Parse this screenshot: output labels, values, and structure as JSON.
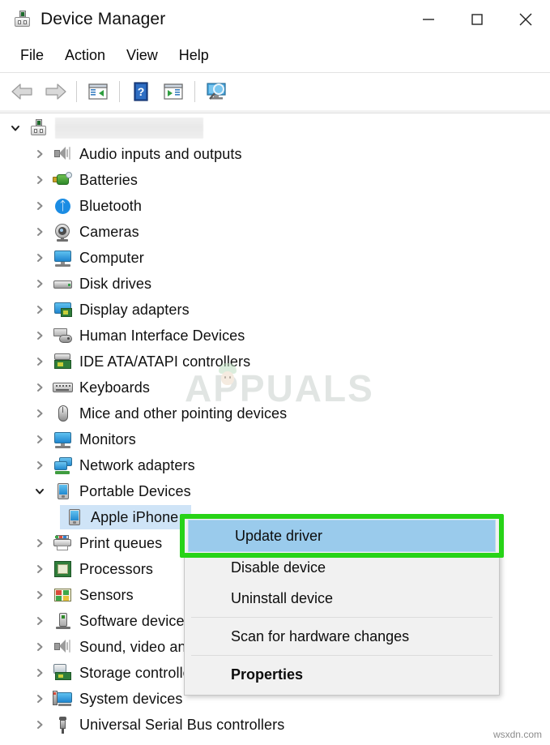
{
  "window": {
    "title": "Device Manager",
    "title_icon": "device-manager-icon",
    "controls": {
      "minimize": "–",
      "maximize": "□",
      "close": "✕"
    }
  },
  "menubar": {
    "items": [
      {
        "label": "File"
      },
      {
        "label": "Action"
      },
      {
        "label": "View"
      },
      {
        "label": "Help"
      }
    ]
  },
  "toolbar": {
    "buttons": [
      {
        "name": "back-button",
        "icon": "back-arrow-icon"
      },
      {
        "name": "forward-button",
        "icon": "forward-arrow-icon"
      },
      {
        "name": "properties-button",
        "icon": "properties-window-icon"
      },
      {
        "name": "help-button",
        "icon": "help-question-icon"
      },
      {
        "name": "update-driver-button",
        "icon": "play-window-icon"
      },
      {
        "name": "scan-hardware-button",
        "icon": "scan-monitor-icon"
      }
    ]
  },
  "tree": {
    "root": {
      "label": "",
      "redacted": true,
      "icon": "computer-root-icon",
      "expanded": true
    },
    "items": [
      {
        "label": "Audio inputs and outputs",
        "icon": "speaker-icon",
        "depth": 1,
        "expanded": false
      },
      {
        "label": "Batteries",
        "icon": "battery-icon",
        "depth": 1,
        "expanded": false
      },
      {
        "label": "Bluetooth",
        "icon": "bluetooth-icon",
        "depth": 1,
        "expanded": false
      },
      {
        "label": "Cameras",
        "icon": "camera-icon",
        "depth": 1,
        "expanded": false
      },
      {
        "label": "Computer",
        "icon": "monitor-icon",
        "depth": 1,
        "expanded": false
      },
      {
        "label": "Disk drives",
        "icon": "disk-drive-icon",
        "depth": 1,
        "expanded": false
      },
      {
        "label": "Display adapters",
        "icon": "display-adapter-icon",
        "depth": 1,
        "expanded": false
      },
      {
        "label": "Human Interface Devices",
        "icon": "hid-icon",
        "depth": 1,
        "expanded": false
      },
      {
        "label": "IDE ATA/ATAPI controllers",
        "icon": "ide-controller-icon",
        "depth": 1,
        "expanded": false
      },
      {
        "label": "Keyboards",
        "icon": "keyboard-icon",
        "depth": 1,
        "expanded": false
      },
      {
        "label": "Mice and other pointing devices",
        "icon": "mouse-icon",
        "depth": 1,
        "expanded": false
      },
      {
        "label": "Monitors",
        "icon": "monitor-icon",
        "depth": 1,
        "expanded": false
      },
      {
        "label": "Network adapters",
        "icon": "network-adapter-icon",
        "depth": 1,
        "expanded": false
      },
      {
        "label": "Portable Devices",
        "icon": "portable-device-icon",
        "depth": 1,
        "expanded": true
      },
      {
        "label": "Apple iPhone",
        "icon": "portable-device-icon",
        "depth": 2,
        "selected": true
      },
      {
        "label": "Print queues",
        "icon": "printer-icon",
        "depth": 1,
        "expanded": false
      },
      {
        "label": "Processors",
        "icon": "processor-icon",
        "depth": 1,
        "expanded": false
      },
      {
        "label": "Sensors",
        "icon": "sensor-icon",
        "depth": 1,
        "expanded": false
      },
      {
        "label": "Software devices",
        "icon": "software-device-icon",
        "depth": 1,
        "expanded": false
      },
      {
        "label": "Sound, video and game controllers",
        "icon": "speaker-icon",
        "depth": 1,
        "expanded": false
      },
      {
        "label": "Storage controllers",
        "icon": "storage-controller-icon",
        "depth": 1,
        "expanded": false
      },
      {
        "label": "System devices",
        "icon": "system-device-icon",
        "depth": 1,
        "expanded": false
      },
      {
        "label": "Universal Serial Bus controllers",
        "icon": "usb-icon",
        "depth": 1,
        "expanded": false
      }
    ]
  },
  "context_menu": {
    "items": [
      {
        "label": "Update driver",
        "highlighted": true,
        "bold": false
      },
      {
        "label": "Disable device",
        "highlighted": false,
        "bold": false
      },
      {
        "label": "Uninstall device",
        "highlighted": false,
        "bold": false
      },
      {
        "label": "Scan for hardware changes",
        "highlighted": false,
        "bold": false
      },
      {
        "label": "Properties",
        "highlighted": false,
        "bold": true
      }
    ]
  },
  "annotation": {
    "color": "#27d317",
    "target": "Update driver"
  },
  "watermarks": {
    "brand": "APPUALS",
    "site": "wsxdn.com"
  },
  "colors": {
    "selection_blue": "#cfe4f7",
    "menu_highlight_blue": "#9acbec",
    "annotation_green": "#27d317",
    "menu_background": "#f1f1f1"
  }
}
